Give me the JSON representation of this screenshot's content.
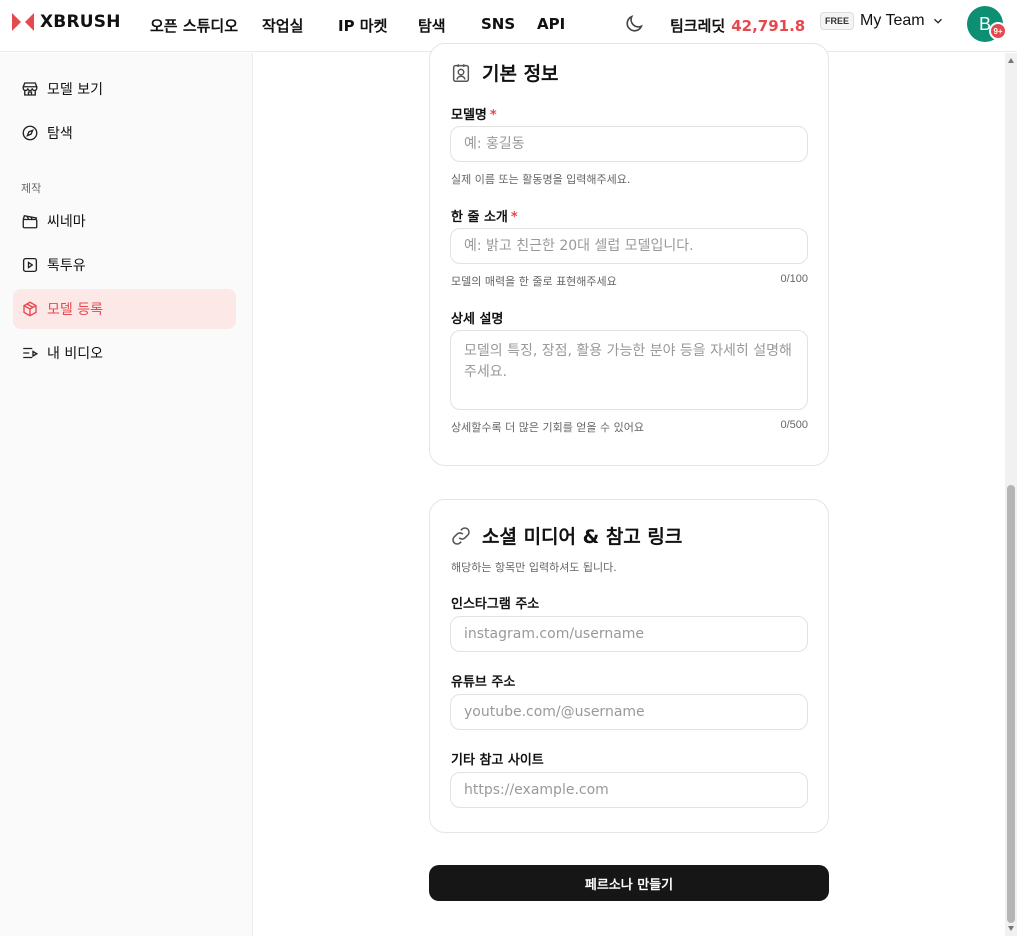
{
  "header": {
    "logo_text": "XBRUSH",
    "nav": [
      "오픈 스튜디오",
      "작업실",
      "IP 마켓",
      "탐색",
      "SNS",
      "API"
    ],
    "credit_label": "팀크레딧",
    "credit_value": "42,791.8",
    "plan_badge": "FREE",
    "team_name": "My Team",
    "avatar_initial": "B",
    "avatar_badge": "9+"
  },
  "sidebar": {
    "top_items": [
      {
        "label": "모델 보기",
        "icon": "store-icon"
      },
      {
        "label": "탐색",
        "icon": "compass-icon"
      }
    ],
    "section_label": "제작",
    "section_items": [
      {
        "label": "씨네마",
        "icon": "clapperboard-icon"
      },
      {
        "label": "톡투유",
        "icon": "play-square-icon"
      },
      {
        "label": "모델 등록",
        "icon": "box-icon",
        "active": true
      },
      {
        "label": "내 비디오",
        "icon": "video-list-icon"
      }
    ]
  },
  "basic_info": {
    "title": "기본 정보",
    "name_label": "모델명",
    "name_placeholder": "예: 홍길동",
    "name_hint": "실제 이름 또는 활동명을 입력해주세요.",
    "intro_label": "한 줄 소개",
    "intro_placeholder": "예: 밝고 친근한 20대 셀럽 모델입니다.",
    "intro_hint": "모델의 매력을 한 줄로 표현해주세요",
    "intro_counter": "0/100",
    "desc_label": "상세 설명",
    "desc_placeholder": "모델의 특징, 장점, 활용 가능한 분야 등을 자세히 설명해주세요.",
    "desc_hint": "상세할수록 더 많은 기회를 얻을 수 있어요",
    "desc_counter": "0/500",
    "required_mark": "*"
  },
  "social": {
    "title": "소셜 미디어 & 참고 링크",
    "subtitle": "해당하는 항목만 입력하셔도 됩니다.",
    "instagram_label": "인스타그램 주소",
    "instagram_placeholder": "instagram.com/username",
    "youtube_label": "유튜브 주소",
    "youtube_placeholder": "youtube.com/@username",
    "other_label": "기타 참고 사이트",
    "other_placeholder": "https://example.com"
  },
  "submit_label": "페르소나 만들기",
  "colors": {
    "accent": "#e5484d",
    "avatar": "#0c8f73",
    "active_bg": "#fde8e8",
    "button_bg": "#161616"
  }
}
